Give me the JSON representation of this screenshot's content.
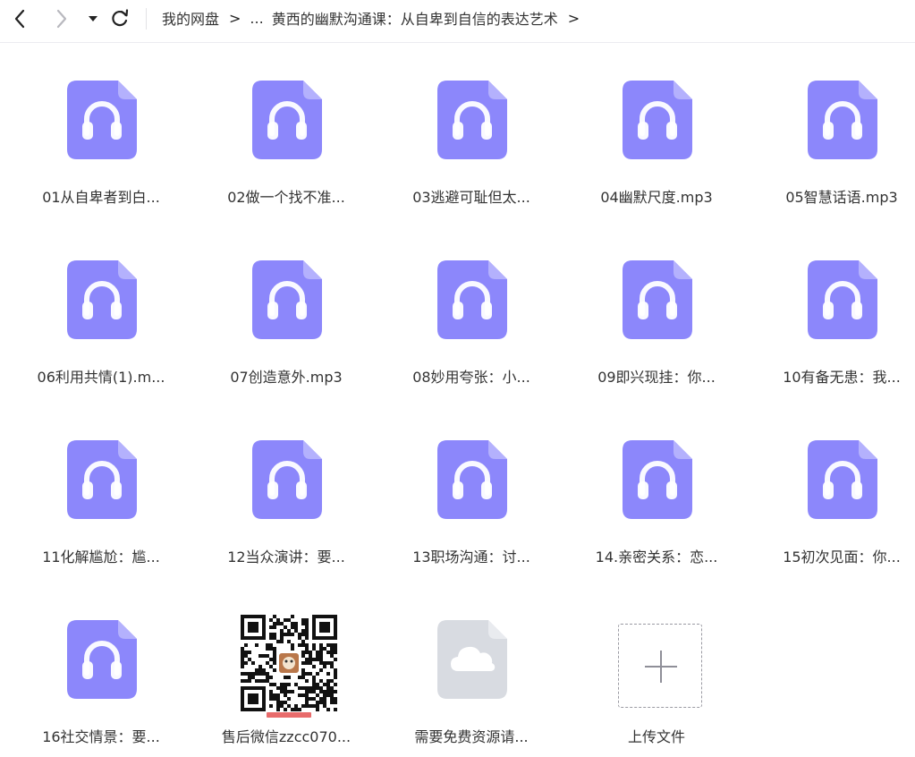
{
  "nav": {
    "back_icon": "chevron-left-icon",
    "forward_icon": "chevron-right-icon",
    "history_icon": "caret-down-icon",
    "refresh_icon": "refresh-icon"
  },
  "breadcrumb": {
    "root": "我的网盘",
    "separator": ">",
    "ellipsis": "...",
    "current": "黄西的幽默沟通课：从自卑到自信的表达艺术",
    "trailing_separator": ">"
  },
  "colors": {
    "audio_icon": "#8c87fb",
    "audio_icon_fold": "#b4b1fd",
    "cloud_icon": "#d8dbe1"
  },
  "files": [
    {
      "name": "01从自卑者到白...",
      "icon": "headphones-file-icon"
    },
    {
      "name": "02做一个找不准...",
      "icon": "headphones-file-icon"
    },
    {
      "name": "03逃避可耻但太...",
      "icon": "headphones-file-icon"
    },
    {
      "name": "04幽默尺度.mp3",
      "icon": "headphones-file-icon"
    },
    {
      "name": "05智慧话语.mp3",
      "icon": "headphones-file-icon"
    },
    {
      "name": "06利用共情(1).m...",
      "icon": "headphones-file-icon"
    },
    {
      "name": "07创造意外.mp3",
      "icon": "headphones-file-icon"
    },
    {
      "name": "08妙用夸张：小...",
      "icon": "headphones-file-icon"
    },
    {
      "name": "09即兴现挂：你...",
      "icon": "headphones-file-icon"
    },
    {
      "name": "10有备无患：我...",
      "icon": "headphones-file-icon"
    },
    {
      "name": "11化解尴尬：尴...",
      "icon": "headphones-file-icon"
    },
    {
      "name": "12当众演讲：要...",
      "icon": "headphones-file-icon"
    },
    {
      "name": "13职场沟通：讨...",
      "icon": "headphones-file-icon"
    },
    {
      "name": "14.亲密关系：恋...",
      "icon": "headphones-file-icon"
    },
    {
      "name": "15初次见面：你...",
      "icon": "headphones-file-icon"
    },
    {
      "name": "16社交情景：要...",
      "icon": "headphones-file-icon"
    },
    {
      "name": "售后微信zzcc070...",
      "icon": "qr-code-image"
    },
    {
      "name": "需要免费资源请...",
      "icon": "cloud-file-icon"
    },
    {
      "name": "上传文件",
      "icon": "plus-icon"
    }
  ]
}
